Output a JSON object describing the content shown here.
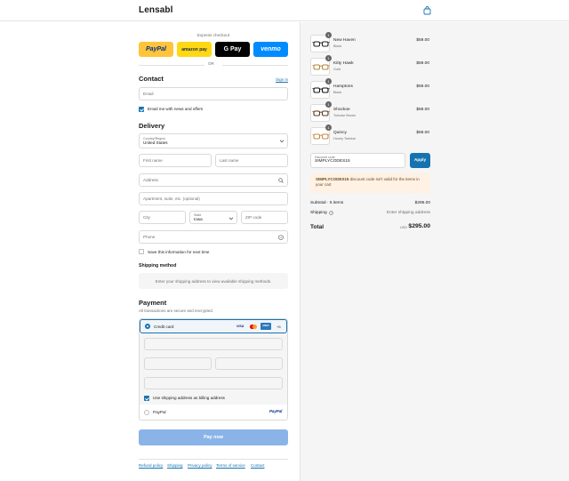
{
  "header": {
    "brand": "Lensabl",
    "cart_icon": "shopping-bag-icon"
  },
  "express": {
    "label": "Express checkout",
    "buttons": [
      {
        "label": "PayPal",
        "bg": "#ffc439",
        "fg": "#003087"
      },
      {
        "label": "amazon pay",
        "bg": "#ffd814",
        "fg": "#232f3e"
      },
      {
        "label": "G Pay",
        "bg": "#000000",
        "fg": "#ffffff"
      },
      {
        "label": "venmo",
        "bg": "#008cff",
        "fg": "#ffffff"
      }
    ],
    "or": "OR"
  },
  "contact": {
    "title": "Contact",
    "sign_in": "Sign in",
    "email_placeholder": "Email",
    "news_label": "Email me with news and offers"
  },
  "delivery": {
    "title": "Delivery",
    "country_label": "Country/Region",
    "country_value": "United States",
    "first_name": "First name",
    "last_name": "Last name",
    "address": "Address",
    "apartment": "Apartment, suite, etc. (optional)",
    "city": "City",
    "state_label": "State",
    "state_value": "Iowa",
    "zip": "ZIP code",
    "phone": "Phone",
    "save_info": "Save this information for next time"
  },
  "shipping_method": {
    "title": "Shipping method",
    "message": "Enter your shipping address to view available shipping methods."
  },
  "payment": {
    "title": "Payment",
    "subtitle": "All transactions are secure and encrypted.",
    "credit_card_label": "Credit card",
    "card_brands": [
      "VISA",
      "mastercard",
      "AMEX"
    ],
    "more_cards": "+5",
    "billing_label": "Use shipping address as billing address",
    "paypal_label": "PayPal",
    "pay_now": "Pay now"
  },
  "footer": {
    "links": [
      "Refund policy",
      "Shipping",
      "Privacy policy",
      "Terms of service",
      "Contact"
    ]
  },
  "order": {
    "items": [
      {
        "name": "New Haven",
        "color": "Black",
        "price": "$59.00",
        "qty": "1",
        "frame_color": "#222222"
      },
      {
        "name": "Kitty Hawk",
        "color": "Gold",
        "price": "$59.00",
        "qty": "1",
        "frame_color": "#b08a3c"
      },
      {
        "name": "Hamptons",
        "color": "Black",
        "price": "$59.00",
        "qty": "1",
        "frame_color": "#111111"
      },
      {
        "name": "Shockoe",
        "color": "Tortoise Brown",
        "price": "$59.00",
        "qty": "1",
        "frame_color": "#5a3a22"
      },
      {
        "name": "Quincy",
        "color": "Honey Tortoise",
        "price": "$59.00",
        "qty": "1",
        "frame_color": "#c58a4a"
      }
    ],
    "discount_label": "Discount code",
    "discount_value": "SIMPLYCODES15",
    "apply": "Apply",
    "warning_code": "SIMPLYCODES15",
    "warning_text": " discount code isn't valid for the items in your cart",
    "subtotal_label": "Subtotal · 5 items",
    "subtotal_value": "$295.00",
    "shipping_label": "Shipping",
    "shipping_value": "Enter shipping address",
    "total_label": "Total",
    "currency": "USD",
    "total_value": "$295.00"
  }
}
